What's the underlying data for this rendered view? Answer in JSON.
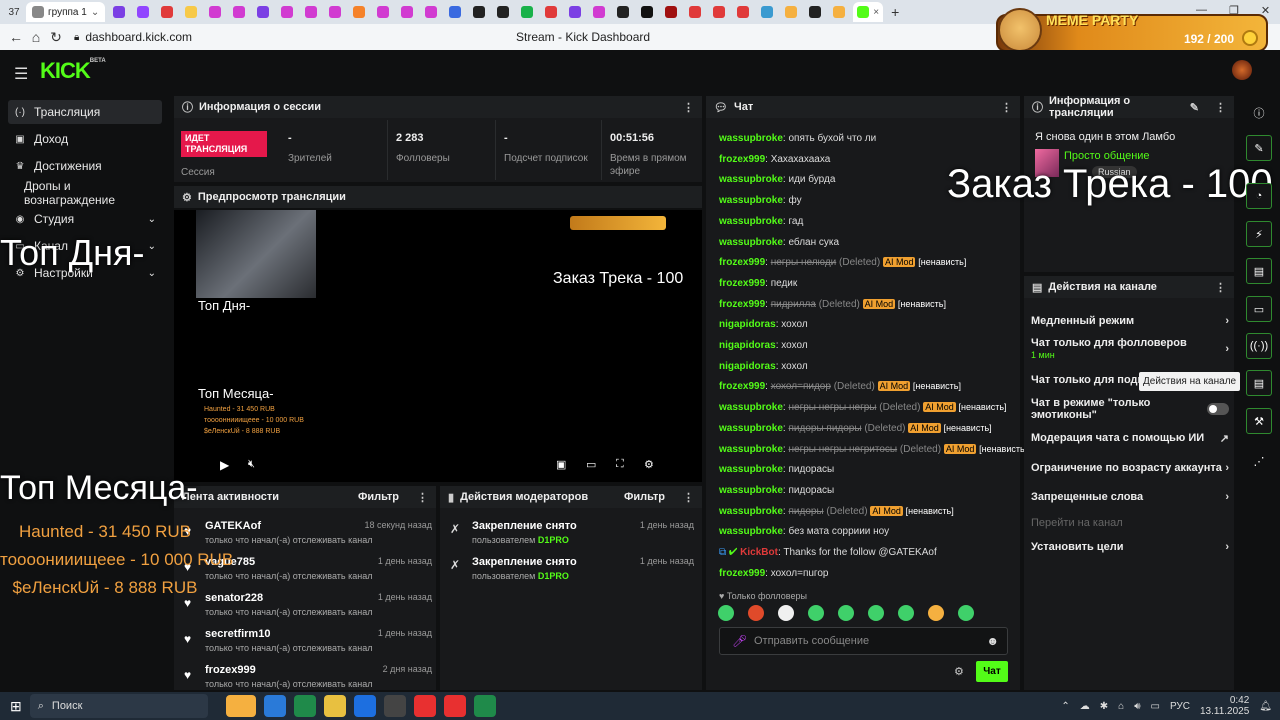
{
  "browser": {
    "tab_count": "37",
    "first_tab": "группа 1",
    "tab_close": "×",
    "url": "dashboard.kick.com",
    "page_title": "Stream - Kick Dashboard",
    "window_min": "—",
    "window_max": "❐",
    "window_close": "✕",
    "back": "←",
    "home": "⌂",
    "reload": "↻",
    "tab_icons": [
      "#7b3fe4",
      "#9146ff",
      "#e03a3a",
      "#f7c948",
      "#d13bd1",
      "#d13bd1",
      "#7b3fe4",
      "#d13bd1",
      "#d13bd1",
      "#d13bd1",
      "#f5822a",
      "#d13bd1",
      "#d13bd1",
      "#d13bd1",
      "#3a6ae0",
      "#222",
      "#222",
      "#19b24a",
      "#e03a3a",
      "#7b3fe4",
      "#d13bd1",
      "#222",
      "#111",
      "#a01010",
      "#e03a3a",
      "#e03a3a",
      "#e03a3a",
      "#3a9ad0",
      "#f5b040",
      "#222",
      "#f5b040"
    ]
  },
  "meme_party": {
    "title": "MEME PARTY",
    "count": "192 / 200"
  },
  "app": {
    "logo": "KICK",
    "logo_sup": "BETA"
  },
  "sidebar": {
    "items": [
      {
        "label": "Трансляция",
        "icon": "broadcast-icon",
        "glyph": "(·)"
      },
      {
        "label": "Доход",
        "icon": "money-icon",
        "glyph": "▣"
      },
      {
        "label": "Достижения",
        "icon": "trophy-icon",
        "glyph": "♛"
      },
      {
        "label": "Дропы и вознаграждение"
      },
      {
        "label": "Студия",
        "icon": "studio-icon",
        "glyph": "◉",
        "chev": "⌄"
      },
      {
        "label": "Канал",
        "icon": "channel-icon",
        "glyph": "▭",
        "chev": "⌄"
      },
      {
        "label": "Настройки",
        "icon": "gear-icon",
        "glyph": "⚙",
        "chev": "⌄"
      }
    ]
  },
  "session": {
    "header": "Информация о сессии",
    "live_badge": "ИДЕТ ТРАНСЛЯЦИЯ",
    "session_label": "Сессия",
    "stats": [
      {
        "value": "-",
        "label": "Зрителей"
      },
      {
        "value": "2 283",
        "label": "Фолловеры"
      },
      {
        "value": "-",
        "label": "Подсчет подписок"
      },
      {
        "value": "00:51:56",
        "label": "Время в прямом эфире"
      }
    ]
  },
  "preview": {
    "header": "Предпросмотр трансляции",
    "top_day": "Топ Дня-",
    "order": "Заказ Трека - 100",
    "top_month": "Топ Месяца-",
    "month_lines": [
      "Haunted - 31 450 RUB",
      "тооооннииищеее - 10 000 RUB",
      "$еЛенскUй - 8 888 RUB"
    ]
  },
  "overlay_big": {
    "top_day": "Топ Дня-",
    "order": "Заказ Трека - 100",
    "top_month": "Топ Месяца-",
    "month_lines": [
      "Haunted - 31 450 RUB",
      "тоооонииищеее - 10 000 RUB",
      "$еЛенскUй - 8 888 RUB"
    ]
  },
  "activity": {
    "header": "Лента активности",
    "filter": "Фильтр",
    "items": [
      {
        "name": "GATEKAof",
        "desc": "только что начал(-а) отслеживать канал",
        "time": "18 секунд назад"
      },
      {
        "name": "vague785",
        "desc": "только что начал(-а) отслеживать канал",
        "time": "1 день назад"
      },
      {
        "name": "senator228",
        "desc": "только что начал(-а) отслеживать канал",
        "time": "1 день назад"
      },
      {
        "name": "secretfirm10",
        "desc": "только что начал(-а) отслеживать канал",
        "time": "1 день назад"
      },
      {
        "name": "frozex999",
        "desc": "только что начал(-а) отслеживать канал",
        "time": "2 дня назад"
      }
    ]
  },
  "mod_actions": {
    "header": "Действия модераторов",
    "filter": "Фильтр",
    "items": [
      {
        "title": "Закрепление снято",
        "by": "пользователем",
        "user": "D1PRO",
        "time": "1 день назад"
      },
      {
        "title": "Закрепление снято",
        "by": "пользователем",
        "user": "D1PRO",
        "time": "1 день назад"
      }
    ]
  },
  "chat": {
    "header": "Чат",
    "followers_only": "Только фолловеры",
    "placeholder": "Отправить сообщение",
    "send": "Чат",
    "messages": [
      {
        "u": "wassupbroke",
        "t": "опять бухой что ли"
      },
      {
        "u": "frozex999",
        "t": "Хахахахааха"
      },
      {
        "u": "wassupbroke",
        "t": "иди бурда"
      },
      {
        "u": "wassupbroke",
        "t": "фу"
      },
      {
        "u": "wassupbroke",
        "t": "гад"
      },
      {
        "u": "wassupbroke",
        "t": "еблан сука"
      },
      {
        "u": "frozex999",
        "t": "негры нелюди",
        "del": true
      },
      {
        "u": "frozex999",
        "t": "педик"
      },
      {
        "u": "frozex999",
        "t": "пидрилла",
        "del": true
      },
      {
        "u": "nigapidoras",
        "t": "хохол"
      },
      {
        "u": "nigapidoras",
        "t": "хохол"
      },
      {
        "u": "nigapidoras",
        "t": "хохол"
      },
      {
        "u": "frozex999",
        "t": "хохол=пидор",
        "del": true
      },
      {
        "u": "wassupbroke",
        "t": "негры негры негры",
        "del": true
      },
      {
        "u": "wassupbroke",
        "t": "пидоры пидоры",
        "del": true
      },
      {
        "u": "wassupbroke",
        "t": "негры негры негритосы",
        "del": true
      },
      {
        "u": "wassupbroke",
        "t": "пидорасы"
      },
      {
        "u": "wassupbroke",
        "t": "пидорасы"
      },
      {
        "u": "wassupbroke",
        "t": "пидоры",
        "del": true
      },
      {
        "u": "wassupbroke",
        "t": "без мата сорриии ноу"
      },
      {
        "u": "KickBot",
        "t": "Thanks for the follow @GATEKAof",
        "bot": true
      },
      {
        "u": "frozex999",
        "t": "хохол=пuгор"
      }
    ],
    "deleted_label": "(Deleted)",
    "ai_label": "AI Mod",
    "hate_label": "[ненависть]"
  },
  "stream_info": {
    "header": "Информация о трансляции",
    "title": "Я снова один в этом Ламбо",
    "category": "Просто общение",
    "language": "Russian"
  },
  "channel_actions": {
    "header": "Действия на канале",
    "items": [
      {
        "label": "Медленный режим"
      },
      {
        "label": "Чат только для фолловеров",
        "sub": "1 мин"
      },
      {
        "label": "Чат только для подписчиков"
      },
      {
        "label": "Чат в режиме \"только эмотиконы\"",
        "toggle": true
      },
      {
        "label": "Модерация чата с помощью ИИ",
        "ext": true
      },
      {
        "label": "Ограничение по возрасту аккаунта"
      },
      {
        "label": "Запрещенные слова"
      },
      {
        "label": "Перейти на канал",
        "disabled": true
      },
      {
        "label": "Установить цели"
      }
    ],
    "tooltip": "Действия на канале"
  },
  "taskbar": {
    "search": "Поиск",
    "lang": "РУС",
    "time": "0:42",
    "date": "13.11.2025"
  }
}
